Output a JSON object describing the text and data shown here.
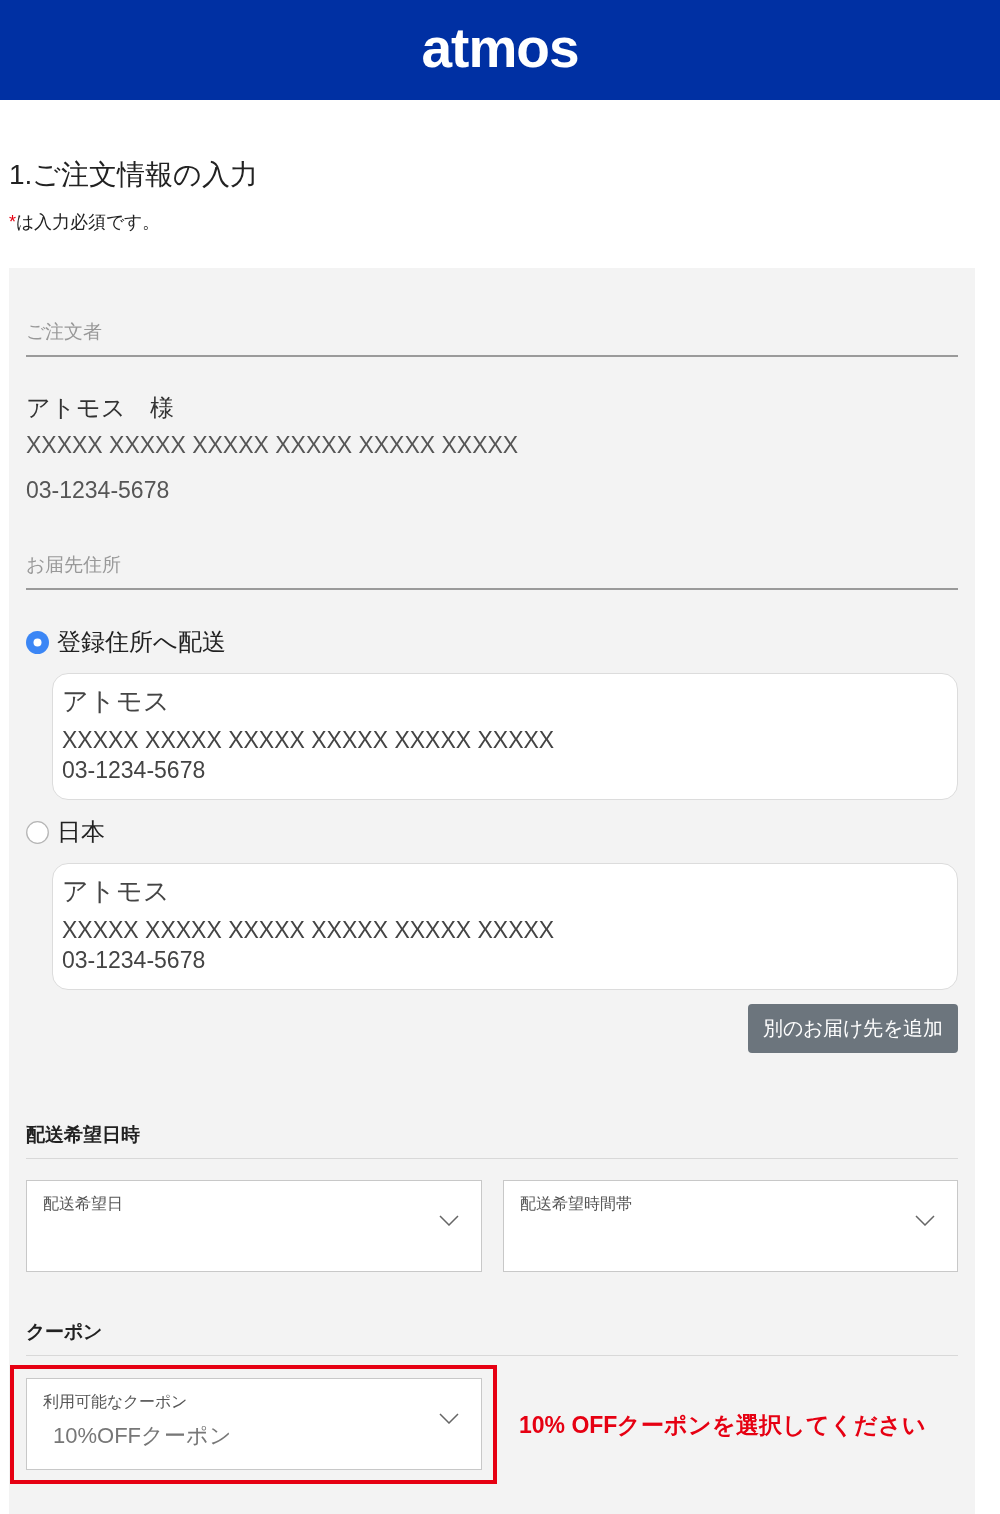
{
  "header": {
    "logo": "atmos"
  },
  "page_title": "1.ご注文情報の入力",
  "required_note": {
    "mark": "*",
    "text": "は入力必須です。"
  },
  "orderer": {
    "label": "ご注文者",
    "name": "アトモス　様",
    "address": "XXXXX XXXXX XXXXX XXXXX XXXXX XXXXX",
    "phone": "03-1234-5678"
  },
  "shipping": {
    "label": "お届先住所",
    "options": [
      {
        "label": "登録住所へ配送",
        "selected": true,
        "name": "アトモス",
        "address": "XXXXX XXXXX XXXXX XXXXX XXXXX XXXXX",
        "phone": "03-1234-5678"
      },
      {
        "label": "日本",
        "selected": false,
        "name": "アトモス",
        "address": "XXXXX XXXXX XXXXX XXXXX XXXXX XXXXX",
        "phone": "03-1234-5678"
      }
    ],
    "add_button": "別のお届け先を追加"
  },
  "delivery": {
    "heading": "配送希望日時",
    "selects": [
      {
        "label": "配送希望日"
      },
      {
        "label": "配送希望時間帯"
      }
    ]
  },
  "coupon": {
    "heading": "クーポン",
    "highlighted": true,
    "select": {
      "label": "利用可能なクーポン",
      "value": "10%OFFクーポン"
    },
    "annotation": "10% OFFクーポンを選択してください"
  }
}
